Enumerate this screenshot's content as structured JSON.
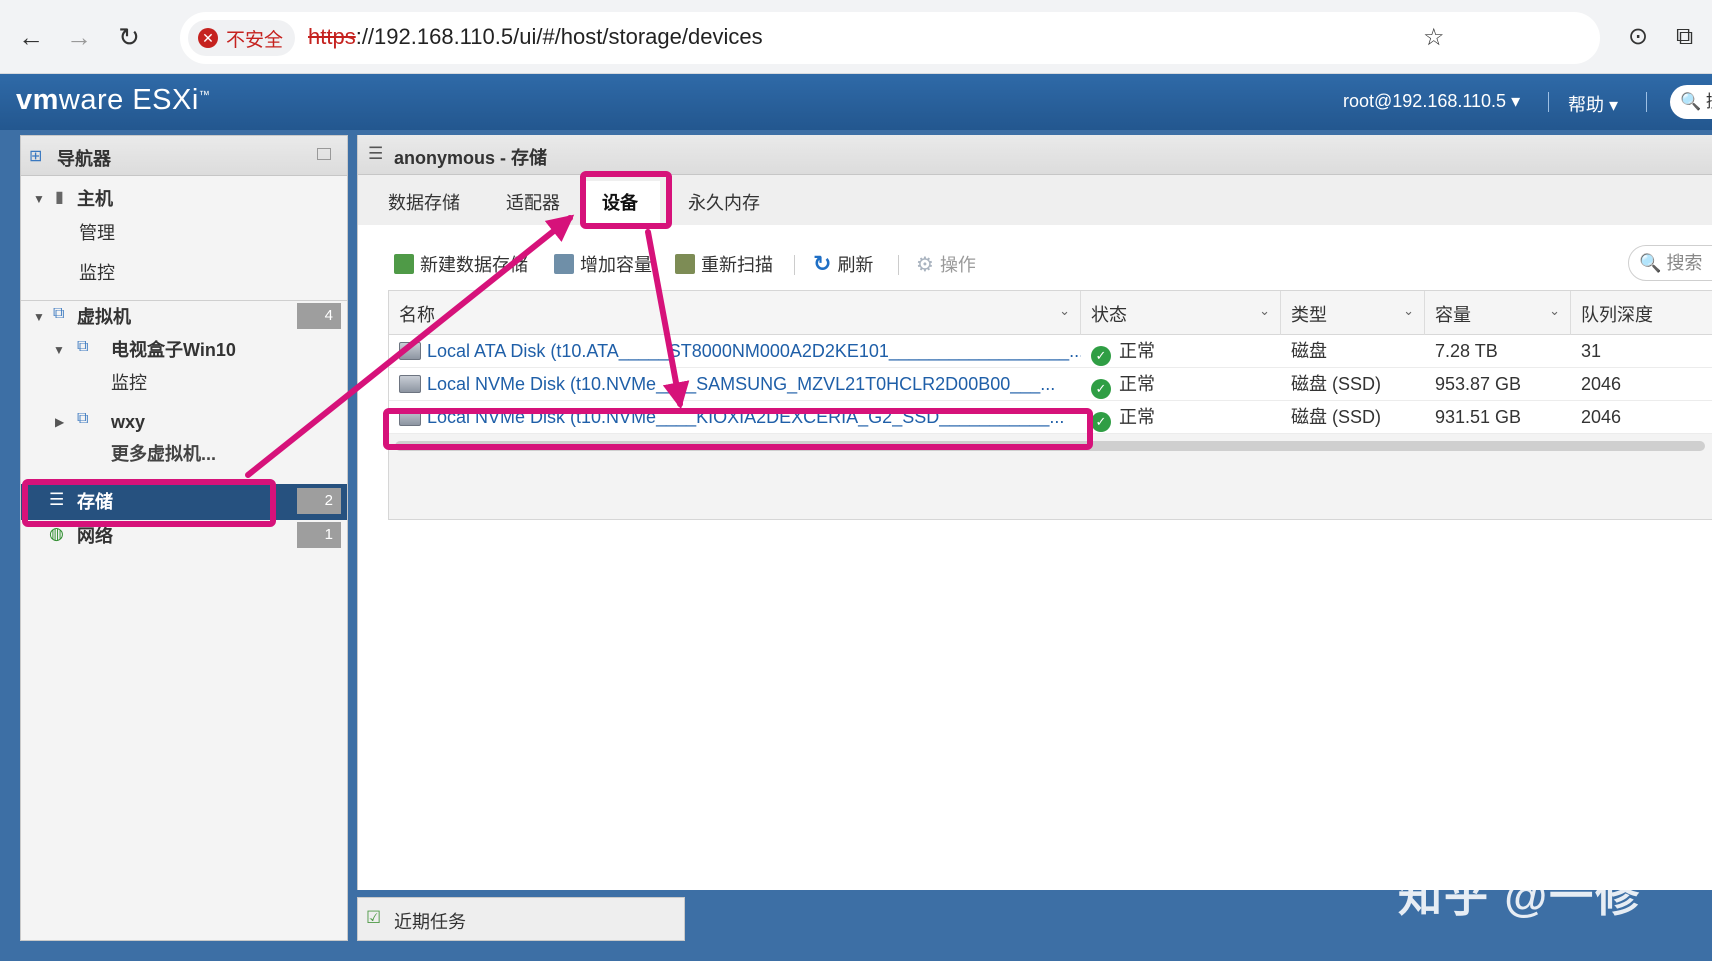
{
  "browser": {
    "back_icon": "arrow-left-icon",
    "forward_icon": "arrow-right-icon",
    "reload_icon": "reload-icon",
    "security_label": "不安全",
    "url_scheme": "https",
    "url_rest": "://192.168.110.5/ui/#/host/storage/devices",
    "bookmark_icon": "star-icon",
    "camera_icon": "camera-icon",
    "extensions_icon": "puzzle-icon"
  },
  "header": {
    "brand_vm": "vm",
    "brand_ware": "ware",
    "brand_product": "ESXi",
    "brand_tm": "™",
    "user_menu": "root@192.168.110.5 ▾",
    "help_menu": "帮助 ▾",
    "search_placeholder": "搜"
  },
  "navigator": {
    "title": "导航器",
    "items": [
      {
        "label": "主机",
        "count": ""
      },
      {
        "label": "管理",
        "count": ""
      },
      {
        "label": "监控",
        "count": ""
      },
      {
        "label": "虚拟机",
        "count": "4"
      },
      {
        "label": "电视盒子Win10",
        "count": ""
      },
      {
        "label": "监控",
        "count": ""
      },
      {
        "label": "wxy",
        "count": ""
      },
      {
        "label": "更多虚拟机...",
        "count": ""
      },
      {
        "label": "存储",
        "count": "2"
      },
      {
        "label": "网络",
        "count": "1"
      }
    ]
  },
  "main": {
    "title": "anonymous - 存储",
    "tabs": [
      {
        "label": "数据存储"
      },
      {
        "label": "适配器"
      },
      {
        "label": "设备"
      },
      {
        "label": "永久内存"
      }
    ],
    "toolbar": {
      "new_datastore": "新建数据存储",
      "increase_capacity": "增加容量",
      "rescan": "重新扫描",
      "refresh": "刷新",
      "actions": "操作",
      "search_placeholder": "搜索"
    },
    "columns": [
      "名称",
      "状态",
      "类型",
      "容量",
      "队列深度"
    ],
    "rows": [
      {
        "name": "Local ATA Disk (t10.ATA_____ST8000NM000A2D2KE101__________________...",
        "status": "正常",
        "type": "磁盘",
        "capacity": "7.28 TB",
        "queue_depth": "31"
      },
      {
        "name": "Local NVMe Disk (t10.NVMe____SAMSUNG_MZVL21T0HCLR2D00B00___...",
        "status": "正常",
        "type": "磁盘 (SSD)",
        "capacity": "953.87 GB",
        "queue_depth": "2046"
      },
      {
        "name": "Local NVMe Disk (t10.NVMe____KIOXIA2DEXCERIA_G2_SSD___________...",
        "status": "正常",
        "type": "磁盘 (SSD)",
        "capacity": "931.51 GB",
        "queue_depth": "2046"
      }
    ]
  },
  "recent_tasks": {
    "label": "近期任务"
  },
  "annotation": {
    "color": "#d6127a",
    "watermark": "知乎 @一修"
  },
  "colors": {
    "header_blue": "#2f6aa8",
    "selected_nav": "#26517f",
    "link_blue": "#1f5fa8",
    "ok_green": "#2f9e44"
  }
}
